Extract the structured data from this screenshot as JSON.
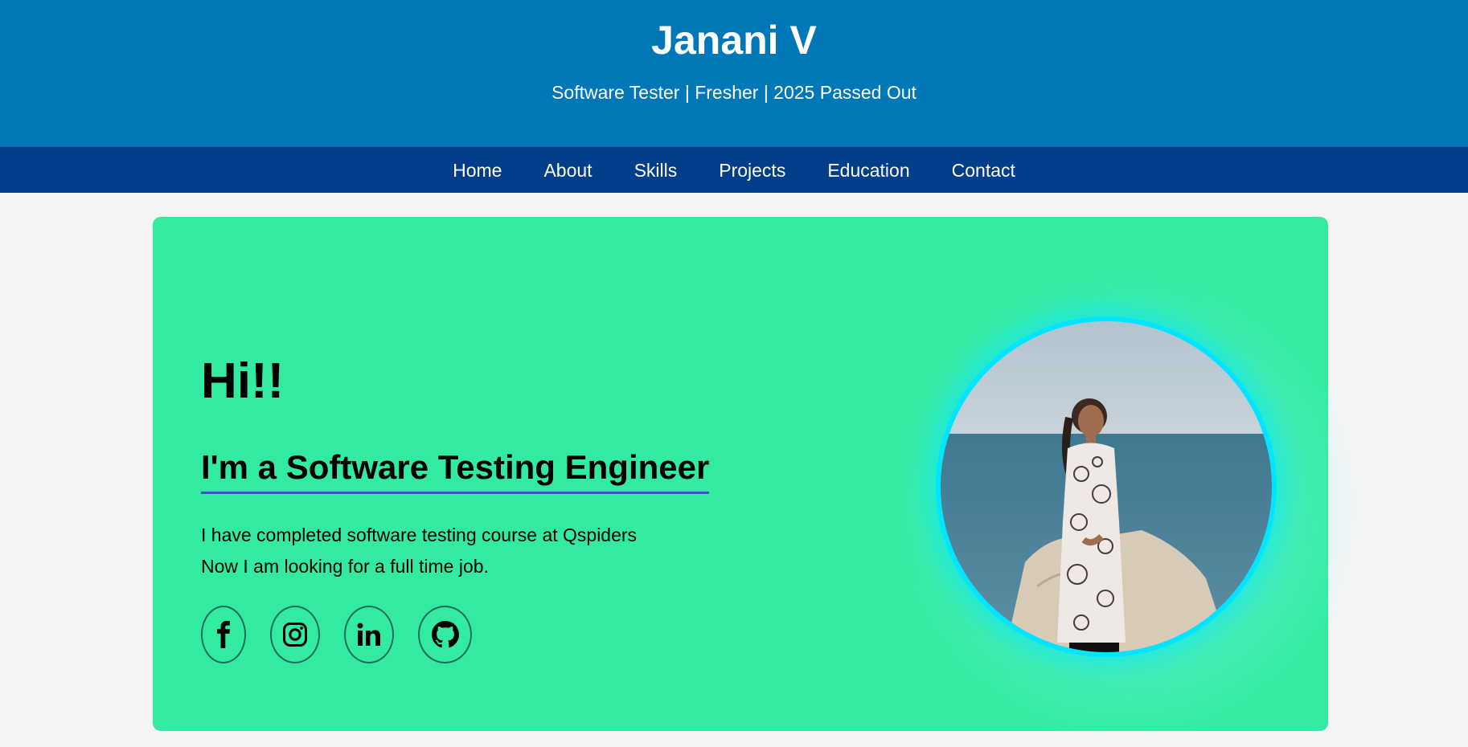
{
  "header": {
    "title": "Janani V",
    "subtitle": "Software Tester | Fresher | 2025 Passed Out"
  },
  "nav": {
    "items": [
      {
        "label": "Home"
      },
      {
        "label": "About"
      },
      {
        "label": "Skills"
      },
      {
        "label": "Projects"
      },
      {
        "label": "Education"
      },
      {
        "label": "Contact"
      }
    ]
  },
  "hero": {
    "greeting": "Hi!!",
    "role": "I'm a Software Testing Engineer",
    "line1": "I have completed software testing course at Qspiders",
    "line2": "Now I am looking for a full time job.",
    "socials": [
      {
        "icon": "facebook-icon"
      },
      {
        "icon": "instagram-icon"
      },
      {
        "icon": "linkedin-icon"
      },
      {
        "icon": "github-icon"
      }
    ]
  },
  "colors": {
    "header_bg": "#0077b6",
    "nav_bg": "#023e8a",
    "hero_bg": "#33eba0",
    "photo_ring": "#00e5ff"
  }
}
